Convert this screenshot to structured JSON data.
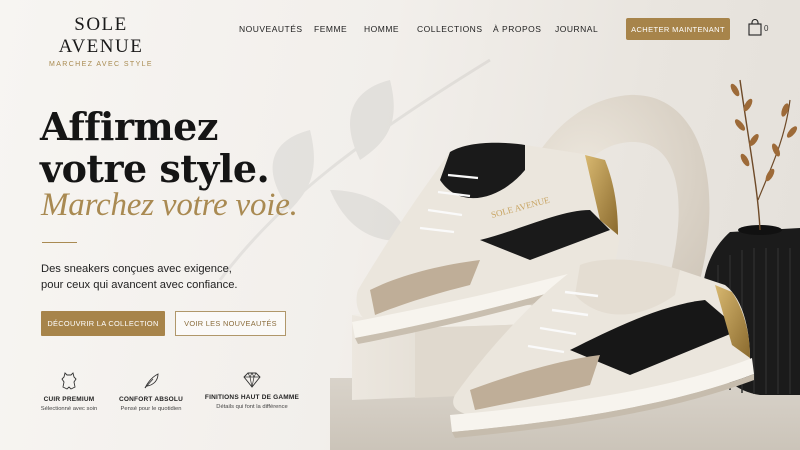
{
  "brand": {
    "name": "SOLE AVENUE",
    "tagline": "MARCHEZ AVEC STYLE"
  },
  "nav": {
    "items": [
      "NOUVEAUTÉS",
      "FEMME",
      "HOMME",
      "COLLECTIONS",
      "À PROPOS",
      "JOURNAL"
    ]
  },
  "header": {
    "cta_label": "ACHETER MAINTENANT",
    "cart_count": "0"
  },
  "hero": {
    "title_line1": "Affirmez",
    "title_line2": "votre style.",
    "title_italic": "Marchez votre voie.",
    "subtitle_line1": "Des sneakers conçues avec exigence,",
    "subtitle_line2": "pour ceux qui avancent avec confiance.",
    "primary_button": "DÉCOUVRIR LA COLLECTION",
    "secondary_button": "VOIR LES NOUVEAUTÉS",
    "shoe_brand_print": "SOLE AVENUE"
  },
  "features": [
    {
      "icon": "leather-hide-icon",
      "title": "CUIR PREMIUM",
      "desc": "Sélectionné avec soin"
    },
    {
      "icon": "feather-icon",
      "title": "CONFORT ABSOLU",
      "desc": "Pensé pour le quotidien"
    },
    {
      "icon": "diamond-icon",
      "title": "FINITIONS HAUT DE GAMME",
      "desc": "Détails qui font la différence"
    }
  ],
  "colors": {
    "accent": "#a7844a",
    "background": "#f2efeb",
    "text": "#151515"
  }
}
